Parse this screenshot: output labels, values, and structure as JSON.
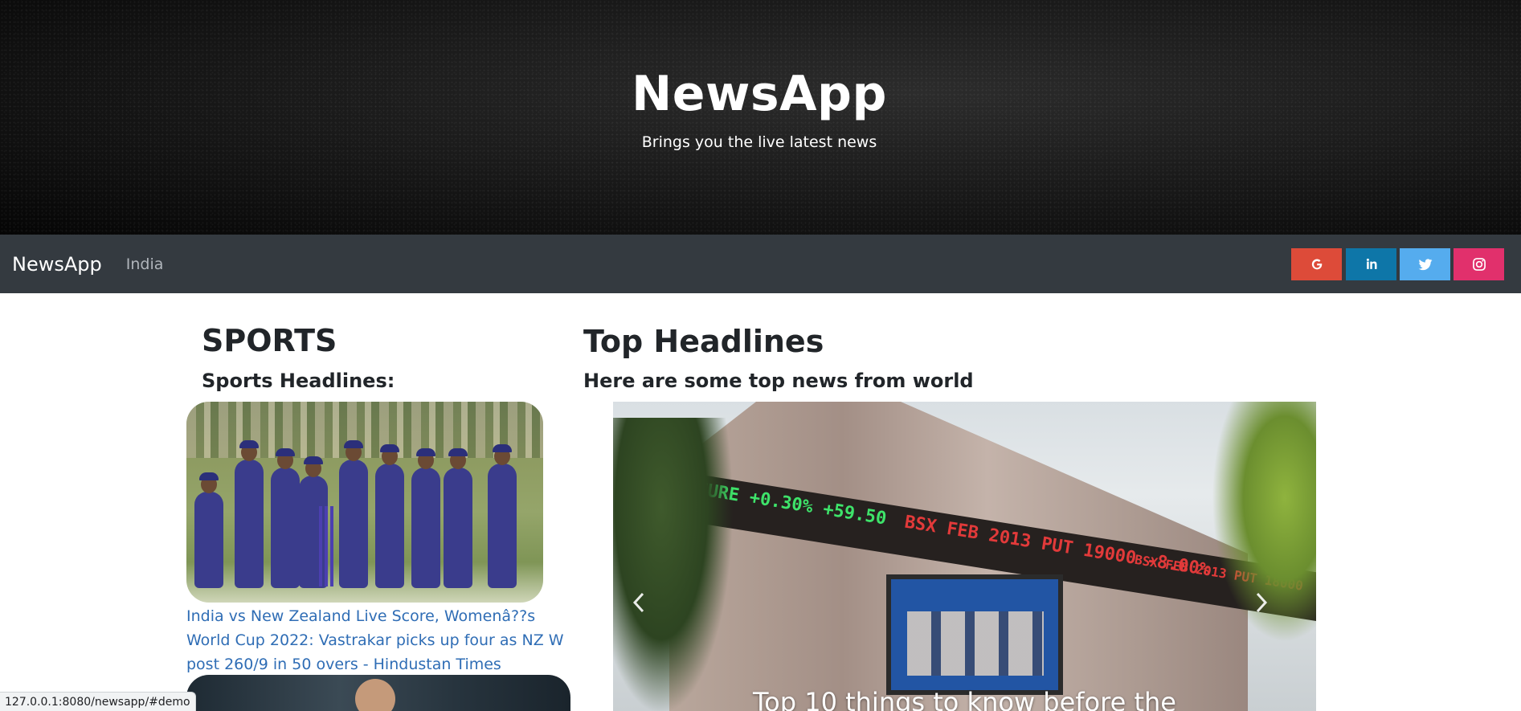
{
  "hero": {
    "title": "NewsApp",
    "subtitle": "Brings you the live latest news"
  },
  "navbar": {
    "brand": "NewsApp",
    "links": [
      "India"
    ],
    "social": [
      {
        "name": "google",
        "icon": "google-icon",
        "color": "#dd4b39"
      },
      {
        "name": "linkedin",
        "icon": "linkedin-icon",
        "color": "#0e76a8"
      },
      {
        "name": "twitter",
        "icon": "twitter-icon",
        "color": "#55acee"
      },
      {
        "name": "instagram",
        "icon": "instagram-icon",
        "color": "#e1306c"
      }
    ]
  },
  "sports": {
    "title": "SPORTS",
    "subtitle": "Sports Headlines:",
    "articles": [
      {
        "headline": "India vs New Zealand Live Score, Womenâ??s World Cup 2022: Vastrakar picks up four as NZ W post 260/9 in 50 overs - Hindustan Times"
      }
    ]
  },
  "top": {
    "title": "Top Headlines",
    "subtitle": "Here are some top news from world",
    "carousel": {
      "caption": "Top 10 things to know before the",
      "ticker": [
        "UTURE +0.30% +59.50",
        "BSX FEB 2013 PUT 19000 -8.00%",
        "BSX FEB 2013 PUT 18000"
      ],
      "prev_icon": "chevron-left-icon",
      "next_icon": "chevron-right-icon"
    }
  },
  "status_bar": {
    "url": "127.0.0.1:8080/newsapp/#demo"
  }
}
